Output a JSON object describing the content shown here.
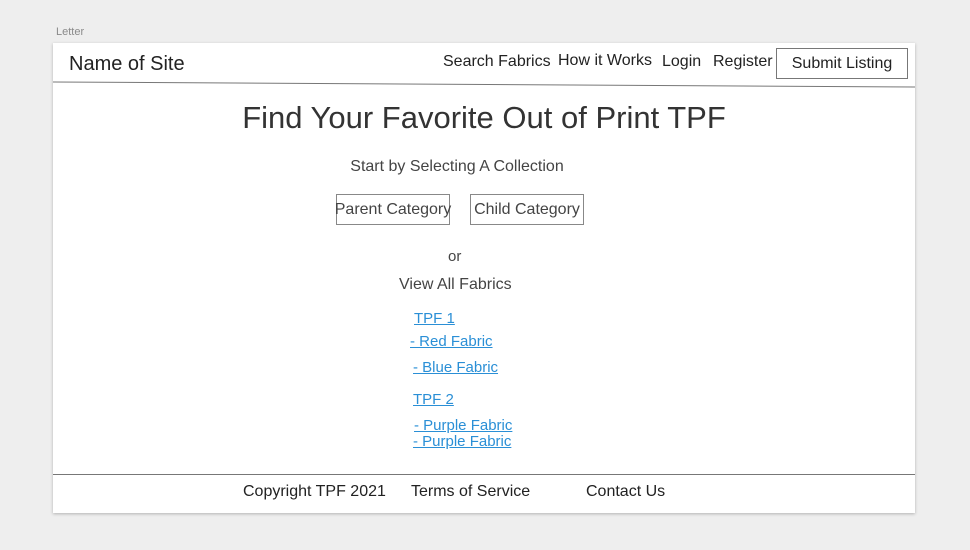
{
  "artboard": {
    "label": "Letter"
  },
  "header": {
    "site_name": "Name of Site",
    "nav": {
      "search": "Search Fabrics",
      "how_it_works": "How it Works",
      "login": "Login",
      "register": "Register",
      "submit": "Submit Listing"
    }
  },
  "main": {
    "headline": "Find Your Favorite Out of Print TPF",
    "subhead": "Start by Selecting A Collection",
    "categories": {
      "parent": "Parent Category",
      "child": "Child Category"
    },
    "or_text": "or",
    "view_all": "View All Fabrics",
    "links": [
      "TPF 1",
      "- Red Fabric",
      "- Blue Fabric",
      "TPF 2",
      "- Purple Fabric",
      "- Purple Fabric"
    ]
  },
  "footer": {
    "copyright": "Copyright TPF 2021",
    "terms": "Terms of Service",
    "contact": "Contact Us"
  },
  "colors": {
    "link": "#2a8fd6",
    "background": "#eeeeee",
    "page": "#ffffff"
  }
}
